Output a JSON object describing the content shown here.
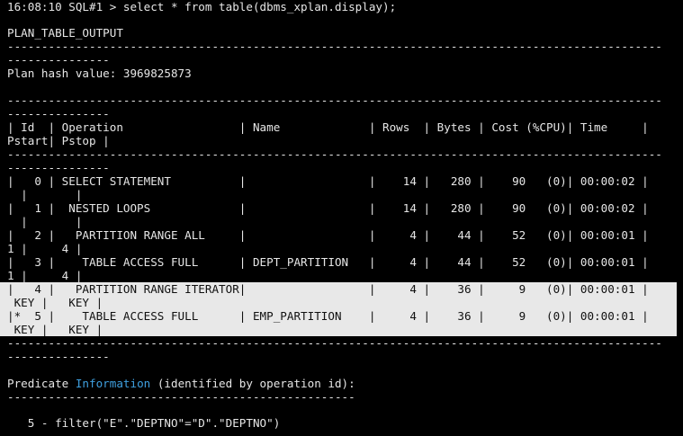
{
  "terminal": {
    "prompt": "16:08:10 SQL#1 > select * from table(dbms_xplan.display);",
    "header": "PLAN_TABLE_OUTPUT",
    "dash_line": "------------------------------------------------------------------------------------------------",
    "dash_short": "---------------",
    "plan_hash": "Plan hash value: 3969825873",
    "col_header_1": "| Id  | Operation                 | Name             | Rows  | Bytes | Cost (%CPU)| Time     |",
    "col_header_2": "Pstart| Pstop |",
    "rows": [
      {
        "l1": "|   0 | SELECT STATEMENT          |                  |    14 |   280 |    90   (0)| 00:00:02 |",
        "l2": "  |       |"
      },
      {
        "l1": "|   1 |  NESTED LOOPS             |                  |    14 |   280 |    90   (0)| 00:00:02 |",
        "l2": "  |       |"
      },
      {
        "l1": "|   2 |   PARTITION RANGE ALL     |                  |     4 |    44 |    52   (0)| 00:00:01 |",
        "l2": "1 |     4 |"
      },
      {
        "l1": "|   3 |    TABLE ACCESS FULL      | DEPT_PARTITION   |     4 |    44 |    52   (0)| 00:00:01 |",
        "l2": "1 |     4 |"
      },
      {
        "l1": "|   4 |   PARTITION RANGE ITERATOR|                  |     4 |    36 |     9   (0)| 00:00:01 |",
        "l2": " KEY |   KEY |"
      },
      {
        "l1": "|*  5 |    TABLE ACCESS FULL      | EMP_PARTITION    |     4 |    36 |     9   (0)| 00:00:01 |",
        "l2": " KEY |   KEY |"
      }
    ],
    "predicate_a": "Predicate ",
    "predicate_kw": "Information",
    "predicate_b": " (identified by operation id):",
    "predicate_dash": "---------------------------------------------------",
    "filter_line": "   5 - filter(\"E\".\"DEPTNO\"=\"D\".\"DEPTNO\")"
  }
}
